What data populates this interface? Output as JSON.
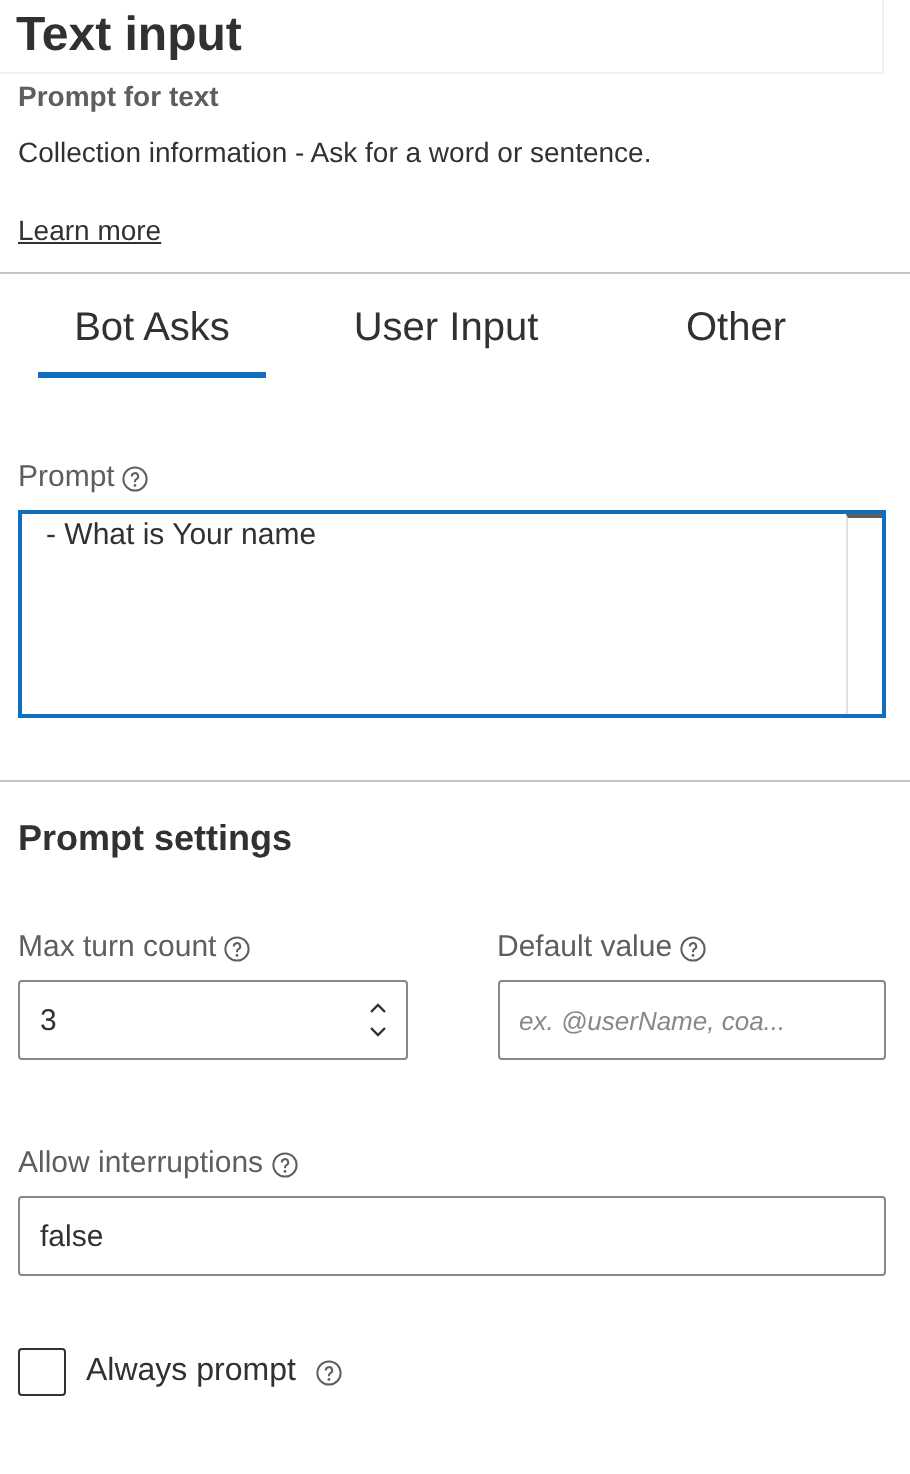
{
  "header": {
    "title": "Text input",
    "subtitle": "Prompt for text",
    "description": "Collection information - Ask for a word or sentence.",
    "link": "Learn more"
  },
  "tabs": [
    {
      "label": "Bot Asks",
      "selected": true
    },
    {
      "label": "User Input",
      "selected": false
    },
    {
      "label": "Other",
      "selected": false
    }
  ],
  "prompt": {
    "label": "Prompt",
    "value": "- What is Your name",
    "focused": true
  },
  "prompt_settings": {
    "title": "Prompt settings",
    "rows": [
      {
        "fields": [
          {
            "kind": "spin",
            "label": "Max turn count",
            "value": "3"
          },
          {
            "kind": "text",
            "label": "Default value",
            "placeholder": "ex. @userName, coa..."
          }
        ]
      },
      {
        "fields": [
          {
            "kind": "text",
            "label": "Allow interruptions",
            "value": "false"
          }
        ]
      },
      {
        "fields": [
          {
            "kind": "checkbox",
            "label": "Always prompt",
            "checked": false
          }
        ]
      }
    ]
  }
}
